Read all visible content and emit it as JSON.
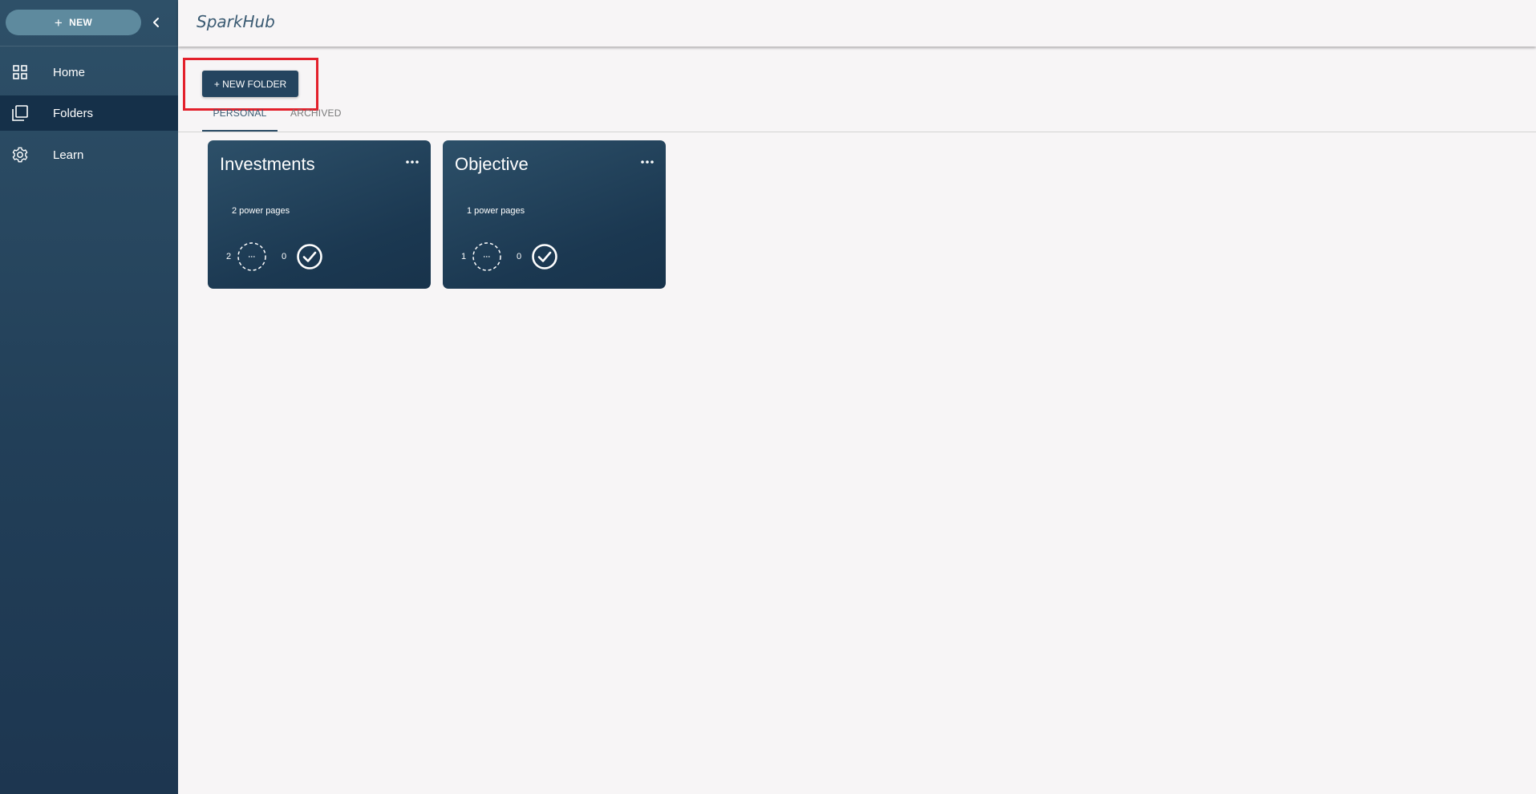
{
  "sidebar": {
    "new_button_label": "NEW",
    "items": [
      {
        "label": "Home",
        "icon": "grid-icon"
      },
      {
        "label": "Folders",
        "icon": "folders-icon",
        "active": true
      },
      {
        "label": "Learn",
        "icon": "gear-icon"
      }
    ]
  },
  "header": {
    "title": "SparkHub"
  },
  "toolbar": {
    "new_folder_label": "+ NEW FOLDER"
  },
  "tabs": [
    {
      "label": "PERSONAL",
      "active": true
    },
    {
      "label": "ARCHIVED",
      "active": false
    }
  ],
  "folders": [
    {
      "title": "Investments",
      "subtitle": "2 power pages",
      "pending": "2",
      "done": "0"
    },
    {
      "title": "Objective",
      "subtitle": "1 power pages",
      "pending": "1",
      "done": "0"
    }
  ],
  "colors": {
    "sidebar": "#2e5068",
    "sidebar_active": "#153049",
    "new_button": "#5e8a9e",
    "card": "#1f3d56",
    "highlight": "#e3202b"
  }
}
